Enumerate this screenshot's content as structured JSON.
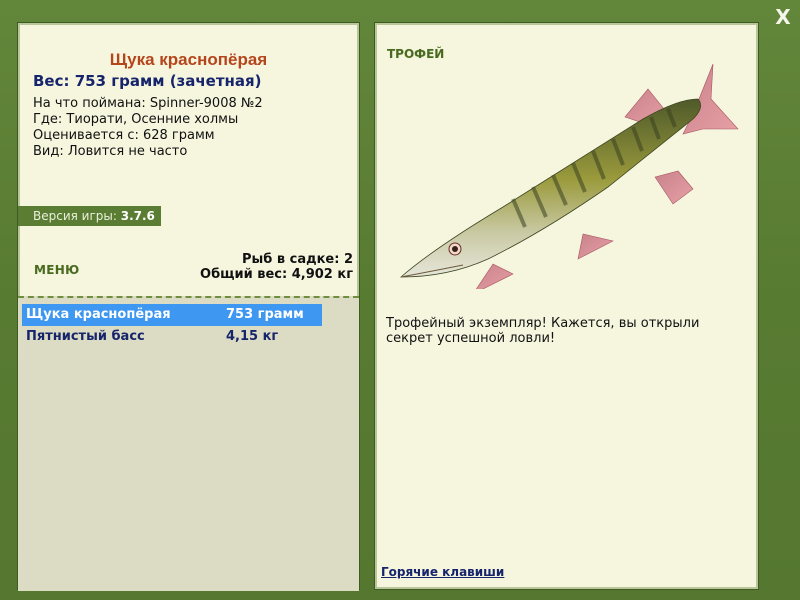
{
  "window": {
    "close_label": "X"
  },
  "fish": {
    "title": "Щука краснопёрая",
    "weight_line": "Вес: 753 грамм (зачетная)",
    "caught_with": "На что поймана: Spinner-9008 №2",
    "location": "Где: Тиорати, Осенние холмы",
    "rated_from": "Оценивается с: 628 грамм",
    "rarity": "Вид: Ловится не часто"
  },
  "version": {
    "label": "Версия игры: ",
    "value": "3.7.6"
  },
  "menu": {
    "label": "МЕНЮ"
  },
  "stats": {
    "fish_count": "Рыб в садке: 2",
    "total_weight": "Общий вес: 4,902 кг"
  },
  "catch_list": [
    {
      "name": "Щука краснопёрая",
      "weight": "753 грамм",
      "selected": true
    },
    {
      "name": "Пятнистый басс",
      "weight": "4,15 кг",
      "selected": false
    }
  ],
  "trophy": {
    "label": "ТРОФЕЙ",
    "text": "Трофейный экземпляр! Кажется, вы открыли секрет успешной ловли!"
  },
  "hotkeys": {
    "label": "Горячие клавиши"
  },
  "colors": {
    "frame_green": "#5a7d34",
    "panel_cream": "#f6f6df",
    "title_orange": "#b5451b",
    "navy_text": "#16246b",
    "selection_blue": "#3e97f0"
  },
  "icons": {
    "close": "close-icon",
    "fish_illustration": "pike-fish-image"
  }
}
